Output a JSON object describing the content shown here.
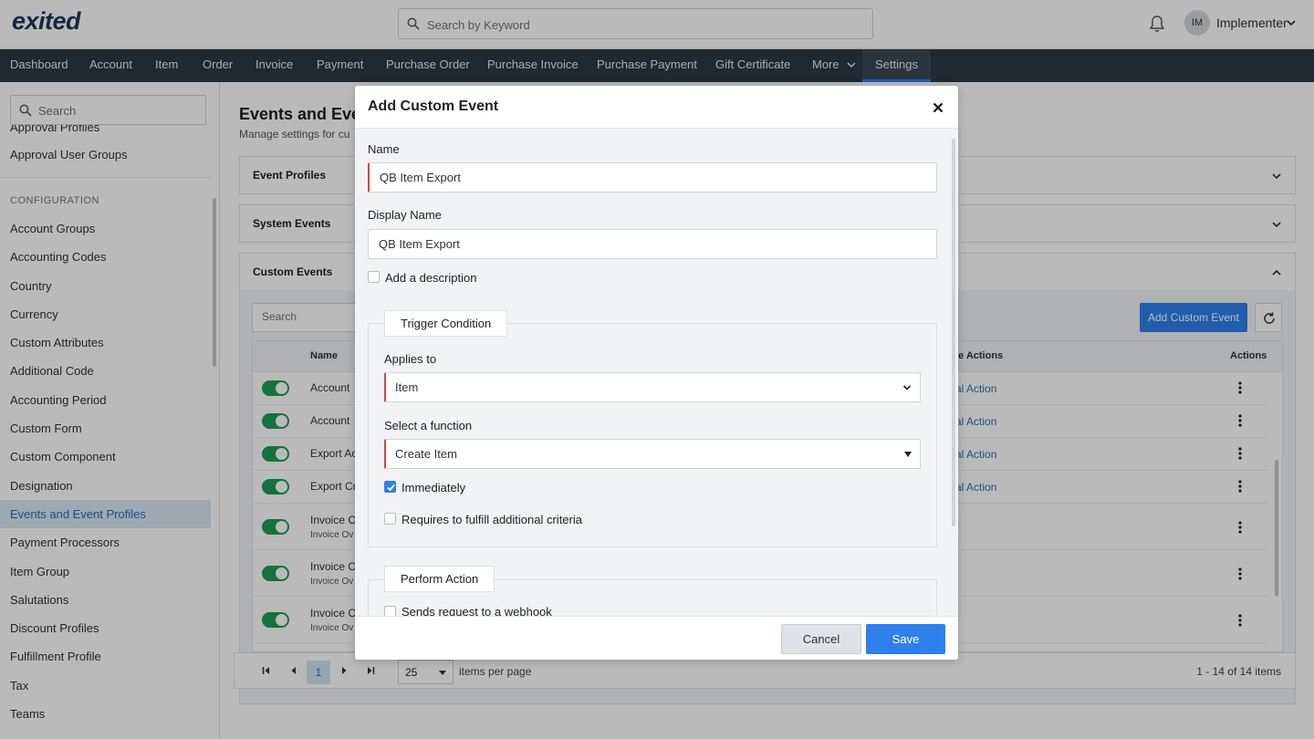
{
  "header": {
    "logo": "exited",
    "search_placeholder": "Search by Keyword",
    "user_initials": "IM",
    "user_name": "Implementer"
  },
  "nav": {
    "items": [
      "Dashboard",
      "Account",
      "Item",
      "Order",
      "Invoice",
      "Payment",
      "Purchase Order",
      "Purchase Invoice",
      "Purchase Payment",
      "Gift Certificate",
      "More",
      "Settings"
    ],
    "active": "Settings"
  },
  "sidebar": {
    "search_placeholder": "Search",
    "top_items": [
      "Approval Profiles",
      "Approval User Groups"
    ],
    "section_heading": "CONFIGURATION",
    "items": [
      "Account Groups",
      "Accounting Codes",
      "Country",
      "Currency",
      "Custom Attributes",
      "Additional Code",
      "Accounting Period",
      "Custom Form",
      "Custom Component",
      "Designation",
      "Events and Event Profiles",
      "Payment Processors",
      "Item Group",
      "Salutations",
      "Discount Profiles",
      "Fulfillment Profile",
      "Tax",
      "Teams"
    ],
    "active": "Events and Event Profiles"
  },
  "main": {
    "title": "Events and Even",
    "subtitle": "Manage settings for cu",
    "panels": [
      "Event Profiles",
      "System Events",
      "Custom Events"
    ],
    "table_search_placeholder": "Search",
    "add_button": "Add Custom Event",
    "columns": {
      "name": "Name",
      "actions_col": "le Actions",
      "actions": "Actions"
    },
    "rows": [
      {
        "name": "Account",
        "sub": "",
        "link": "al Action"
      },
      {
        "name": "Account",
        "sub": "",
        "link": "al Action"
      },
      {
        "name": "Export Ac",
        "sub": "",
        "link": "al Action"
      },
      {
        "name": "Export Cr",
        "sub": "",
        "link": "al Action"
      },
      {
        "name": "Invoice O",
        "sub": "Invoice Ov",
        "link": ""
      },
      {
        "name": "Invoice O",
        "sub": "Invoice Ov",
        "link": ""
      },
      {
        "name": "Invoice O",
        "sub": "Invoice Ov",
        "link": ""
      }
    ],
    "pager": {
      "page": "1",
      "page_size": "25",
      "items_per_page": "items per page",
      "count": "1 - 14 of 14 items"
    }
  },
  "modal": {
    "title": "Add Custom Event",
    "name_label": "Name",
    "name_value": "QB Item Export",
    "display_name_label": "Display Name",
    "display_name_value": "QB Item Export",
    "add_description_label": "Add a description",
    "add_description_checked": false,
    "trigger_legend": "Trigger Condition",
    "applies_to_label": "Applies to",
    "applies_to_value": "Item",
    "function_label": "Select a function",
    "function_value": "Create Item",
    "immediately_label": "Immediately",
    "immediately_checked": true,
    "criteria_label": "Requires to fulfill additional criteria",
    "criteria_checked": false,
    "perform_legend": "Perform Action",
    "webhook_label": "Sends request to a webhook",
    "cancel": "Cancel",
    "save": "Save"
  },
  "colors": {
    "navbar": "#2b3947",
    "accent": "#2f80ed",
    "toggle_on": "#1f9d55",
    "required": "#d64545"
  }
}
